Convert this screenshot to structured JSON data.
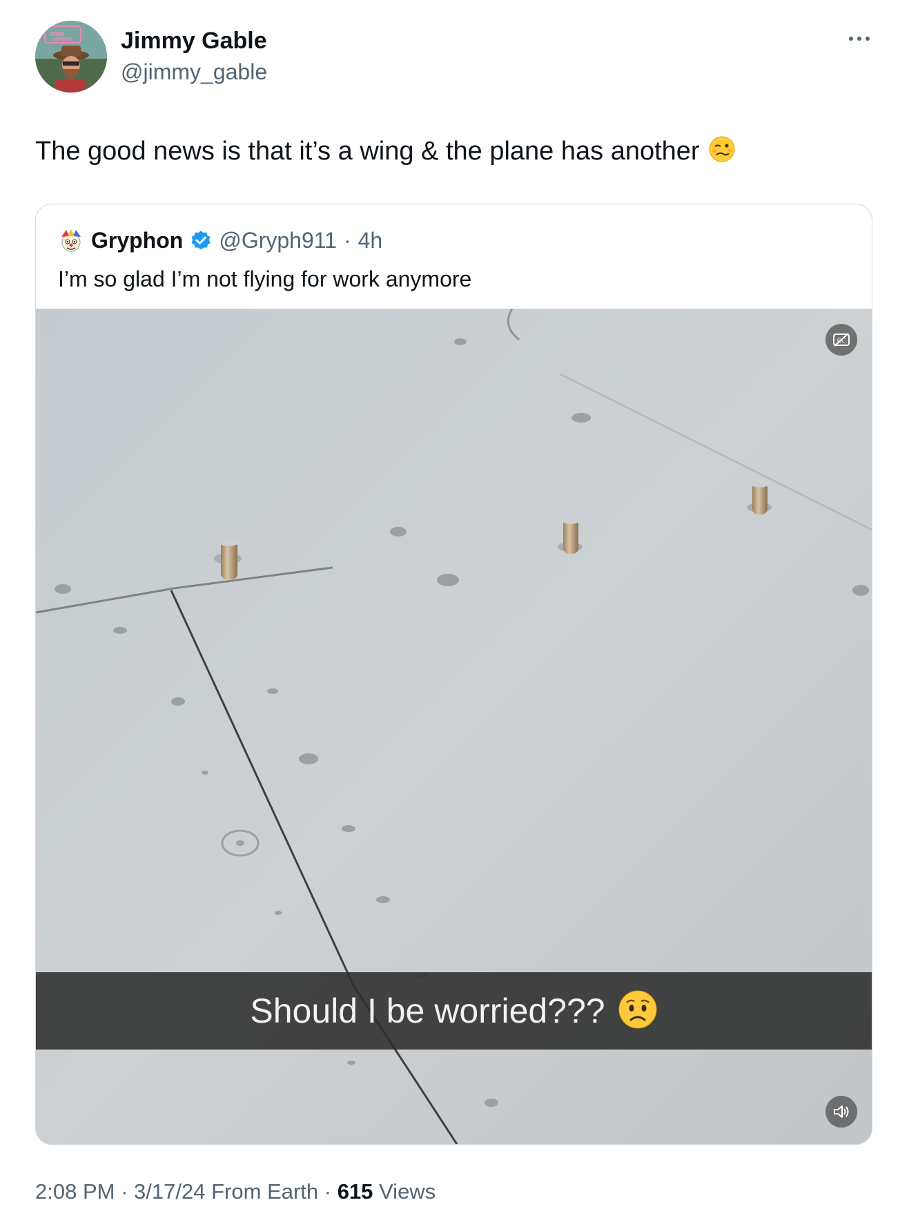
{
  "author": {
    "display_name": "Jimmy Gable",
    "handle": "@jimmy_gable",
    "avatar_icon": "avatar-jimmy-gable"
  },
  "tweet": {
    "text": "The good news is that it’s a wing & the plane has another",
    "emoji_icon": "woozy-face-emoji"
  },
  "quoted": {
    "display_name": "Gryphon",
    "handle": "@Gryph911",
    "separator": "·",
    "age": "4h",
    "verified_color": "#1d9bf0",
    "text": "I’m so glad I’m not flying for work anymore",
    "media": {
      "caption": "Should I be worried???",
      "caption_emoji_icon": "worried-face-emoji",
      "cc_icon": "captions-off-icon",
      "volume_icon": "volume-icon"
    }
  },
  "meta": {
    "time": "2:08 PM",
    "dot1": "·",
    "date": "3/17/24",
    "source": "From Earth",
    "dot2": "·",
    "views_count": "615",
    "views_label": "Views"
  },
  "colors": {
    "text_primary": "#0f1419",
    "text_secondary": "#536471",
    "border": "#cfd9de"
  }
}
